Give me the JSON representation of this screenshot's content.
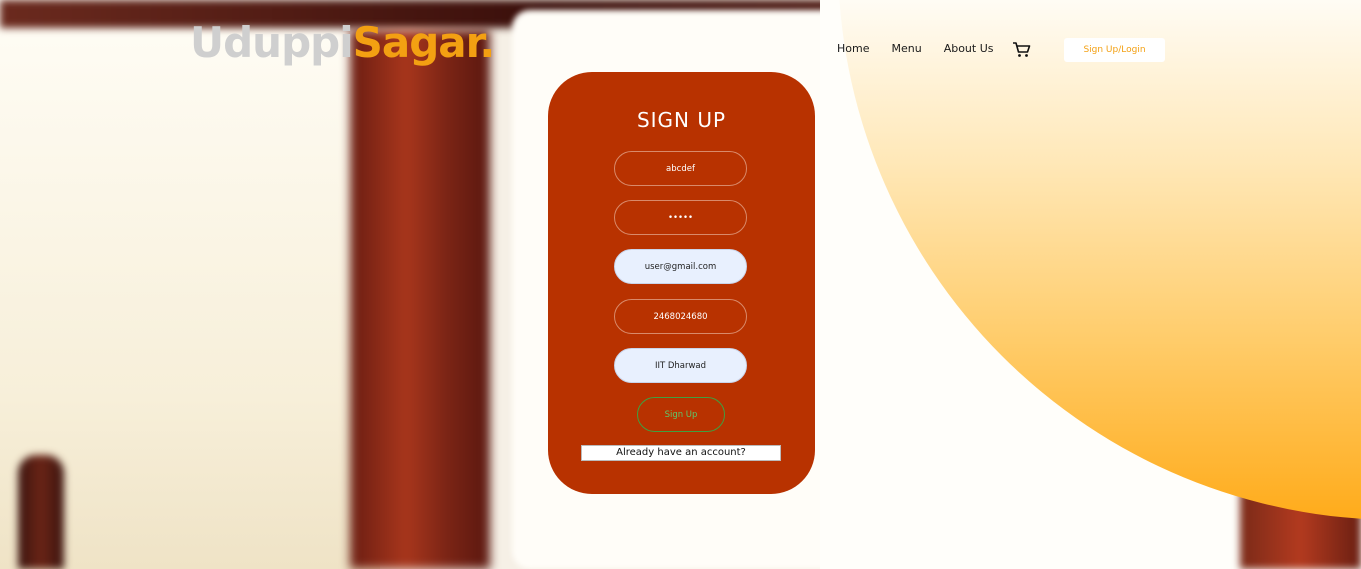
{
  "header": {
    "logo_part1": "Uduppi",
    "logo_part2": "Sagar.",
    "nav": [
      "Home",
      "Menu",
      "About Us"
    ],
    "login_label": "Sign Up/Login"
  },
  "form": {
    "title": "SIGN UP",
    "username": "abcdef",
    "password": "•••••",
    "email": "user@gmail.com",
    "phone": "2468024680",
    "address": "IIT Dharwad",
    "submit_label": "Sign Up",
    "account_link": "Already have an account?"
  },
  "colors": {
    "brand": "#f3a012",
    "card": "#b83200",
    "accent_green": "#3fa040"
  },
  "icons": {
    "cart": "shopping-cart-icon"
  }
}
